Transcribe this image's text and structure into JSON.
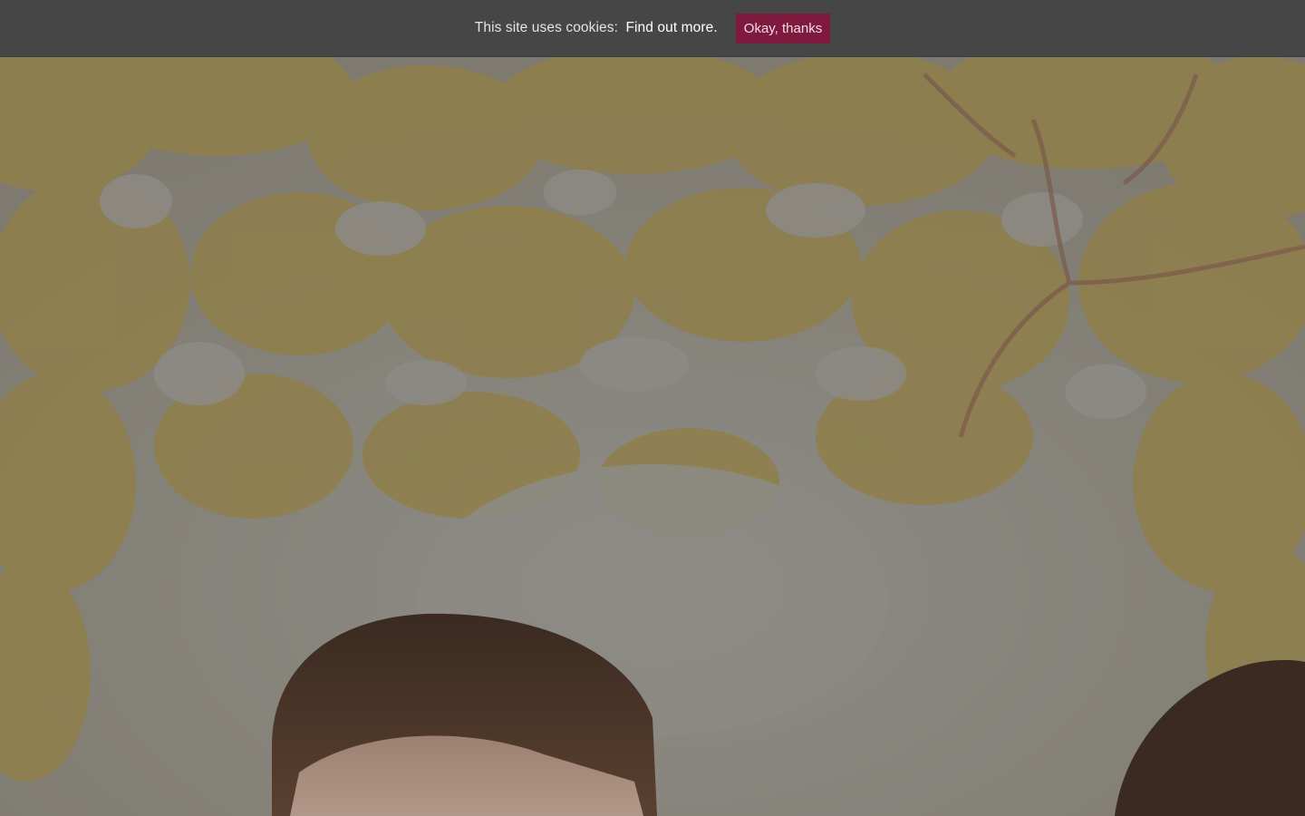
{
  "cookie_bar": {
    "message": "This site uses cookies:",
    "link_text": "Find out more.",
    "button_label": "Okay, thanks"
  },
  "colors": {
    "cookie_bar_bg": "#464646",
    "accent_button": "#7d1a3d"
  }
}
